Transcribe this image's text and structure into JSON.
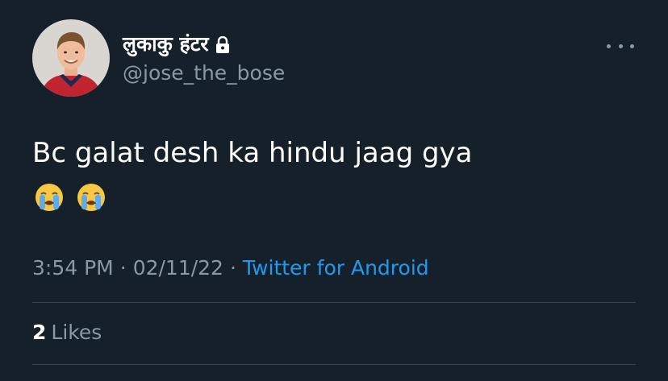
{
  "author": {
    "display_name": "लुकाकु हंटर",
    "handle": "@jose_the_bose",
    "protected": true,
    "avatar_icon": "profile-photo"
  },
  "tweet": {
    "text": "Bc galat desh ka hindu jaag gya",
    "emojis": [
      "loudly-crying-face",
      "loudly-crying-face"
    ]
  },
  "meta": {
    "time": "3:54 PM",
    "separator": "·",
    "date": "02/11/22",
    "source": "Twitter for Android"
  },
  "engagement": {
    "likes_count": "2",
    "likes_label": "Likes"
  },
  "colors": {
    "background": "#15202b",
    "primary_text": "#ffffff",
    "secondary_text": "#8b98a5",
    "link": "#1d9bf0",
    "divider": "#38444d"
  }
}
